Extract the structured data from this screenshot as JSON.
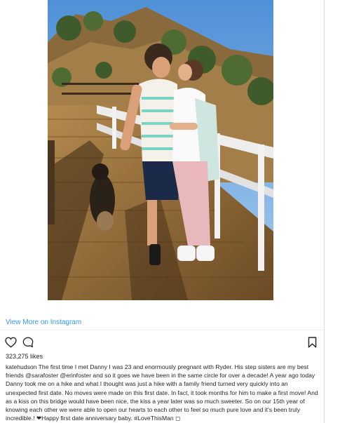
{
  "post": {
    "image_alt": "photo-couple-kissing-on-bridge",
    "view_more_label": "View More on Instagram",
    "likes_label": "323,275 likes",
    "caption_user": "katehudson",
    "caption_text": " The first time I met Danny I was 23 and enormously pregnant with Ryder. His step sisters are my best friends @sarafoster @erinfoster and so it goes we have been in the same circle for over a decade! A year ago today Danny took me on a hike and what I thought was just a hike with a family friend turned very quickly into an unexpected first date. No moves were made on this first date. In fact, it took months for him to make a first move! And as a kiss on this bridge would have been nice, the kiss a year later was so much sweeter. So on our 15th year of knowing each other we were able to open our hearts to each other to feel so much pure love and it's been truly incredible.! ❤Happy first date anniversary baby. #LoveThisMan ◻"
  },
  "icons": {
    "like": "heart-outline-icon",
    "comment": "comment-bubble-icon",
    "save": "bookmark-icon"
  },
  "colors": {
    "link": "#3897f0",
    "text": "#262626",
    "divider": "#efefef"
  }
}
